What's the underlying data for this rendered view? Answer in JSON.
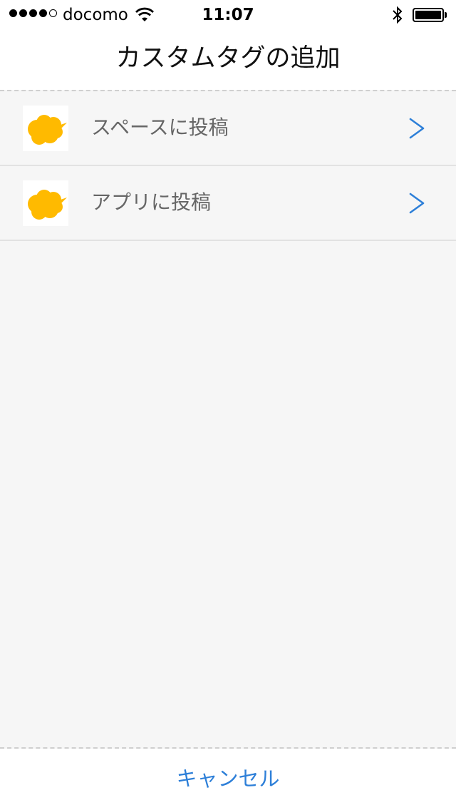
{
  "status_bar": {
    "carrier": "docomo",
    "time": "11:07",
    "signal_bars_filled": 4,
    "signal_bars_total": 5,
    "icons": [
      "signal-dots-icon",
      "wifi-icon",
      "bluetooth-icon",
      "battery-icon"
    ]
  },
  "header": {
    "title": "カスタムタグの追加"
  },
  "list": {
    "items": [
      {
        "label": "スペースに投稿",
        "icon": "cloud-speech-bubble-icon",
        "accessory": "chevron-right-icon"
      },
      {
        "label": "アプリに投稿",
        "icon": "cloud-speech-bubble-icon",
        "accessory": "chevron-right-icon"
      }
    ]
  },
  "footer": {
    "cancel_label": "キャンセル"
  },
  "colors": {
    "accent": "#2d7fd8",
    "icon_yellow": "#ffba00",
    "background": "#f6f6f6",
    "label_gray": "#666666"
  }
}
